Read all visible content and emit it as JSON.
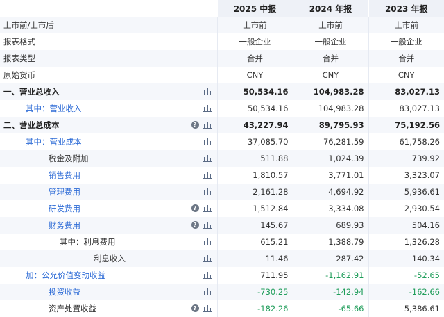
{
  "header": {
    "cols": [
      "2025 中报",
      "2024 年报",
      "2023 年报"
    ]
  },
  "rows": [
    {
      "label": "上市前/上市后",
      "level": 0,
      "style": "plain",
      "chart": false,
      "help": false,
      "align": "center",
      "values": [
        "上市前",
        "上市前",
        "上市前"
      ]
    },
    {
      "label": "报表格式",
      "level": 0,
      "style": "plain",
      "chart": false,
      "help": false,
      "align": "center",
      "values": [
        "一般企业",
        "一般企业",
        "一般企业"
      ]
    },
    {
      "label": "报表类型",
      "level": 0,
      "style": "plain",
      "chart": false,
      "help": false,
      "align": "center",
      "values": [
        "合并",
        "合并",
        "合并"
      ]
    },
    {
      "label": "原始货币",
      "level": 0,
      "style": "plain",
      "chart": false,
      "help": false,
      "align": "center",
      "values": [
        "CNY",
        "CNY",
        "CNY"
      ]
    },
    {
      "label": "一、营业总收入",
      "level": 0,
      "style": "bold",
      "chart": true,
      "help": false,
      "align": "right",
      "values": [
        "50,534.16",
        "104,983.28",
        "83,027.13"
      ]
    },
    {
      "label": "其中：营业收入",
      "level": 1,
      "style": "blue",
      "chart": true,
      "help": false,
      "align": "right",
      "values": [
        "50,534.16",
        "104,983.28",
        "83,027.13"
      ]
    },
    {
      "label": "二、营业总成本",
      "level": 0,
      "style": "bold",
      "chart": true,
      "help": true,
      "align": "right",
      "values": [
        "43,227.94",
        "89,795.93",
        "75,192.56"
      ]
    },
    {
      "label": "其中：营业成本",
      "level": 1,
      "style": "blue",
      "chart": true,
      "help": false,
      "align": "right",
      "values": [
        "37,085.70",
        "76,281.59",
        "61,758.26"
      ]
    },
    {
      "label": "税金及附加",
      "level": 2,
      "style": "plain",
      "chart": true,
      "help": false,
      "align": "right",
      "values": [
        "511.88",
        "1,024.39",
        "739.92"
      ]
    },
    {
      "label": "销售费用",
      "level": 2,
      "style": "blue",
      "chart": true,
      "help": false,
      "align": "right",
      "values": [
        "1,810.57",
        "3,771.01",
        "3,323.07"
      ]
    },
    {
      "label": "管理费用",
      "level": 2,
      "style": "blue",
      "chart": true,
      "help": false,
      "align": "right",
      "values": [
        "2,161.28",
        "4,694.92",
        "5,936.61"
      ]
    },
    {
      "label": "研发费用",
      "level": 2,
      "style": "blue",
      "chart": true,
      "help": true,
      "align": "right",
      "values": [
        "1,512.84",
        "3,334.08",
        "2,930.54"
      ]
    },
    {
      "label": "财务费用",
      "level": 2,
      "style": "blue",
      "chart": true,
      "help": true,
      "align": "right",
      "values": [
        "145.67",
        "689.93",
        "504.16"
      ]
    },
    {
      "label": "其中：利息费用",
      "level": 3,
      "style": "plain",
      "chart": true,
      "help": false,
      "align": "right",
      "values": [
        "615.21",
        "1,388.79",
        "1,326.28"
      ]
    },
    {
      "label": "利息收入",
      "level": 4,
      "style": "plain",
      "chart": true,
      "help": false,
      "align": "right",
      "values": [
        "11.46",
        "287.42",
        "140.34"
      ]
    },
    {
      "label": "加：公允价值变动收益",
      "level": 1,
      "style": "blue",
      "chart": true,
      "help": false,
      "align": "right",
      "values": [
        "711.95",
        "-1,162.91",
        "-52.65"
      ]
    },
    {
      "label": "投资收益",
      "level": 2,
      "style": "blue",
      "chart": true,
      "help": false,
      "align": "right",
      "values": [
        "-730.25",
        "-142.94",
        "-162.66"
      ]
    },
    {
      "label": "资产处置收益",
      "level": 2,
      "style": "plain",
      "chart": true,
      "help": true,
      "align": "right",
      "values": [
        "-182.26",
        "-65.66",
        "5,386.61"
      ]
    }
  ],
  "icons": {
    "chart": "bar-chart-icon",
    "help": "help-icon"
  },
  "colors": {
    "header_bg": "#eef1f7",
    "alt_row": "#f5f7fb",
    "link_blue": "#2d6bd6",
    "negative": "#1f9d5a"
  }
}
